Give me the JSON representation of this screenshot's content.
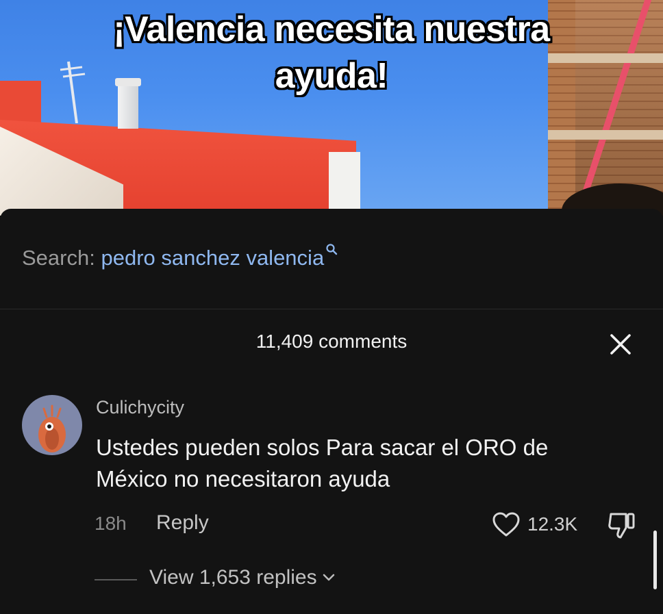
{
  "video": {
    "caption_line1": "¡Valencia necesita nuestra",
    "caption_line2": "ayuda!"
  },
  "search": {
    "label": "Search:",
    "query": "pedro sanchez valencia"
  },
  "comments_header": {
    "title": "11,409 comments"
  },
  "comment": {
    "username": "Culichycity",
    "text_line1": "Ustedes pueden solos Para sacar el ORO de",
    "text_line2": "México no necesitaron ayuda",
    "time": "18h",
    "reply_label": "Reply",
    "like_count": "12.3K",
    "view_replies_label": "View 1,653 replies"
  },
  "icons": {
    "search": "search-icon",
    "close": "close-icon",
    "like": "heart-icon",
    "dislike": "thumbs-down-icon",
    "chevron": "chevron-down-icon"
  },
  "colors": {
    "sheet_bg": "#131313",
    "search_term": "#8fb8f0",
    "avatar_bg": "#7f88aa"
  }
}
